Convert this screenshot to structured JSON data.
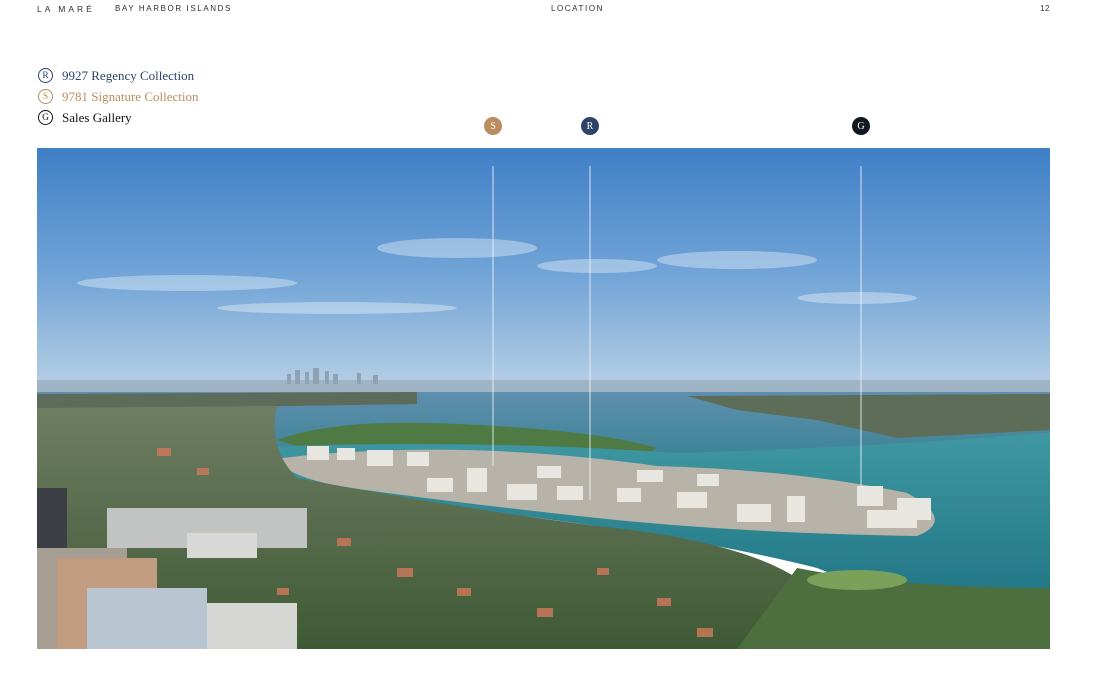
{
  "header": {
    "brand": "LA MARÉ",
    "area": "BAY HARBOR ISLANDS",
    "section": "LOCATION",
    "page_number": "12"
  },
  "legend": {
    "items": [
      {
        "mark": "R",
        "label": "9927 Regency Collection"
      },
      {
        "mark": "S",
        "label": "9781 Signature Collection"
      },
      {
        "mark": "G",
        "label": "Sales Gallery"
      }
    ]
  },
  "pins": [
    {
      "mark": "S"
    },
    {
      "mark": "R"
    },
    {
      "mark": "G"
    }
  ],
  "colors": {
    "regency": "#2d4469",
    "signature": "#b98d5e",
    "gallery": "#111822"
  }
}
